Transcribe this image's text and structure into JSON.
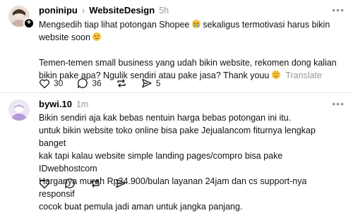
{
  "post1": {
    "username": "poninipu",
    "topic": "WebsiteDesign",
    "time": "5h",
    "text_line1": "Mengsedih tiap lihat potongan Shopee",
    "text_line1b": "sekaligus termotivasi harus bikin",
    "text_line2": "website soon",
    "text_para2_line1": "Temen-temen small business yang udah bikin website, rekomen dong kalian",
    "text_para2_line2": "bikin pake apa? Ngulik sendiri atau pake jasa? Thank youu",
    "translate": "Translate",
    "likes": "30",
    "comments": "36",
    "shares": "5"
  },
  "post2": {
    "username": "bywi.10",
    "time": "1m",
    "lines": [
      "Bikin sendiri aja kak bebas nentuin harga bebas potongan ini itu.",
      "untuk bikin website toko online bisa pake Jejualancom fiturnya lengkap banget",
      "kak tapi kalau website simple landing pages/compro bisa pake IDwebhostcom",
      "Harganya murah Rp34.900/bulan layanan 24jam dan cs support-nya responsif",
      "cocok buat pemula jadi aman untuk jangka panjang."
    ]
  },
  "icons": [
    "plus-icon",
    "heart-icon",
    "comment-icon",
    "repost-icon",
    "share-icon",
    "more-icon",
    "crying-emoji",
    "sad-emoji",
    "relieved-emoji"
  ]
}
